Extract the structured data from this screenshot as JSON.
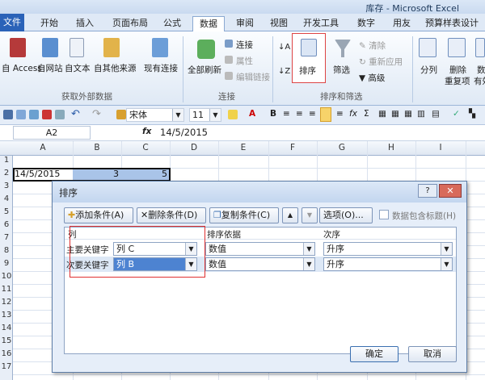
{
  "window": {
    "title": "库存 - Microsoft Excel"
  },
  "tabs": [
    "文件",
    "开始",
    "插入",
    "页面布局",
    "公式",
    "数据",
    "审阅",
    "视图",
    "开发工具",
    "数字",
    "用友",
    "预算样表设计"
  ],
  "ribbon": {
    "external": {
      "access": "自 Access",
      "web": "自网站",
      "text": "自文本",
      "other": "自其他来源",
      "existing": "现有连接",
      "group": "获取外部数据"
    },
    "connections": {
      "refresh": "全部刷新",
      "connections": "连接",
      "properties": "属性",
      "edit_links": "编辑链接",
      "group": "连接"
    },
    "sort_filter": {
      "sort": "排序",
      "filter": "筛选",
      "clear": "清除",
      "reapply": "重新应用",
      "advanced": "高级",
      "group": "排序和筛选"
    },
    "tools": {
      "text_to_columns": "分列",
      "remove_dup_1": "删除",
      "remove_dup_2": "重复项",
      "valid": "数据",
      "valid_2": "有效"
    }
  },
  "toolbar": {
    "font": "宋体",
    "size": "11"
  },
  "formula_bar": {
    "name_box": "A2",
    "fx": "fx",
    "value": "14/5/2015"
  },
  "columns": [
    "A",
    "B",
    "C",
    "D",
    "E",
    "F",
    "G",
    "H",
    "I"
  ],
  "rows": [
    "1",
    "2",
    "3",
    "4",
    "5",
    "6",
    "7",
    "8",
    "9",
    "10",
    "11",
    "12",
    "13",
    "14",
    "15",
    "16",
    "17"
  ],
  "cells": {
    "a2": "14/5/2015",
    "b2": "3",
    "c2": "5"
  },
  "dialog": {
    "title": "排序",
    "add_level": "添加条件(A)",
    "delete_level": "删除条件(D)",
    "copy_level": "复制条件(C)",
    "options": "选项(O)...",
    "has_headers": "数据包含标题(H)",
    "col_header": "列",
    "sort_on_header": "排序依据",
    "order_header": "次序",
    "rows": [
      {
        "label": "主要关键字",
        "column": "列 C",
        "sort_on": "数值",
        "order": "升序"
      },
      {
        "label": "次要关键字",
        "column": "列 B",
        "sort_on": "数值",
        "order": "升序"
      }
    ],
    "ok": "确定",
    "cancel": "取消"
  }
}
